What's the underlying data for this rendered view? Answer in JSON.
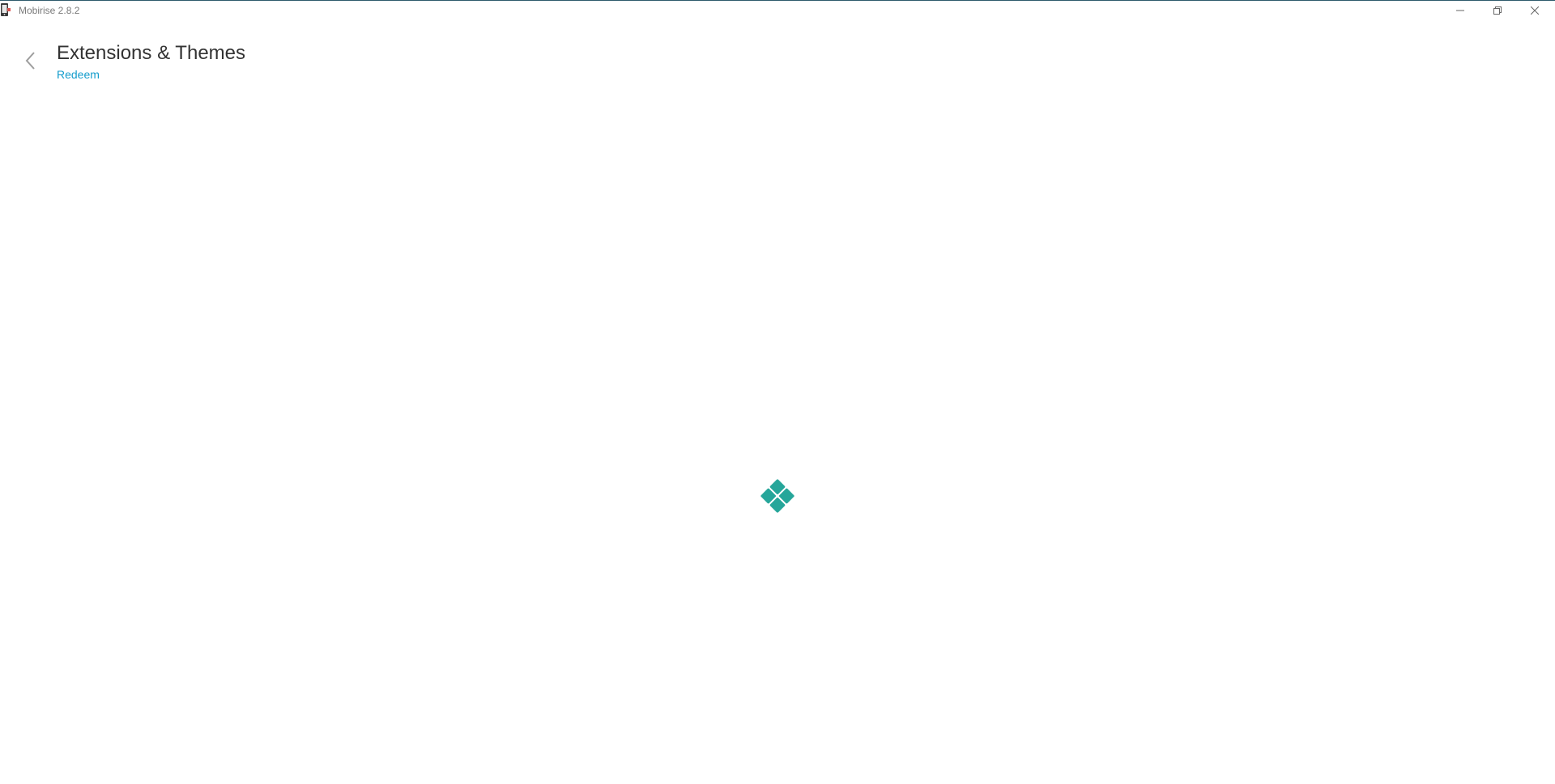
{
  "window": {
    "title": "Mobirise 2.8.2",
    "controls": {
      "minimize_icon": "minimize-icon",
      "maximize_icon": "restore-icon",
      "close_icon": "close-icon"
    }
  },
  "header": {
    "back_icon": "chevron-left-icon",
    "title": "Extensions & Themes",
    "redeem_label": "Redeem"
  },
  "loader": {
    "icon": "loading-spinner-icon"
  },
  "colors": {
    "accent": "#26a69a",
    "link": "#149dcc",
    "title_text": "#333333",
    "titlebar_text": "#7a7a7a",
    "window_border": "#2d5a6b"
  }
}
